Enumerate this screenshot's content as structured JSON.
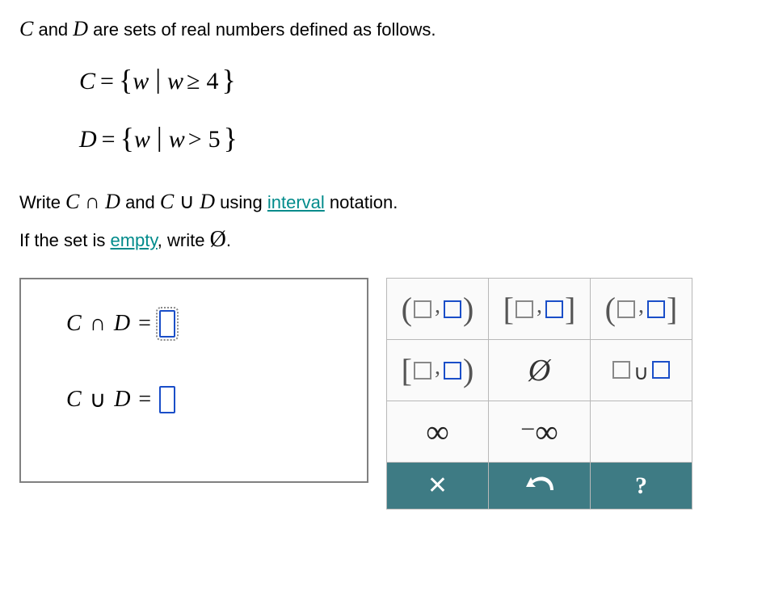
{
  "problem": {
    "intro_pre": " and ",
    "set1_name": "C",
    "set2_name": "D",
    "intro_post": " are sets of real numbers defined as follows."
  },
  "sets": {
    "C": {
      "name": "C",
      "var": "w",
      "rel": "≥",
      "val": "4"
    },
    "D": {
      "name": "D",
      "var": "w",
      "rel": ">",
      "val": "5"
    }
  },
  "instructions": {
    "line1_a": "Write ",
    "line1_b": " and ",
    "line1_c": " using ",
    "link_interval": "interval",
    "line1_d": " notation.",
    "line2_a": "If the set is ",
    "link_empty": "empty",
    "line2_b": ", write ",
    "emptyset": "Ø",
    "line2_c": "."
  },
  "answers": {
    "row1": {
      "left": "C",
      "op": "∩",
      "right": "D"
    },
    "row2": {
      "left": "C",
      "op": "∪",
      "right": "D"
    }
  },
  "palette": {
    "open_open": "(□,□)",
    "closed_closed": "[□,□]",
    "open_closed": "(□,□]",
    "closed_open": "[□,□)",
    "emptyset": "Ø",
    "union": "□∪□",
    "infinity": "∞",
    "neg_infinity": "−∞",
    "clear": "×",
    "undo": "↶",
    "help": "?"
  }
}
